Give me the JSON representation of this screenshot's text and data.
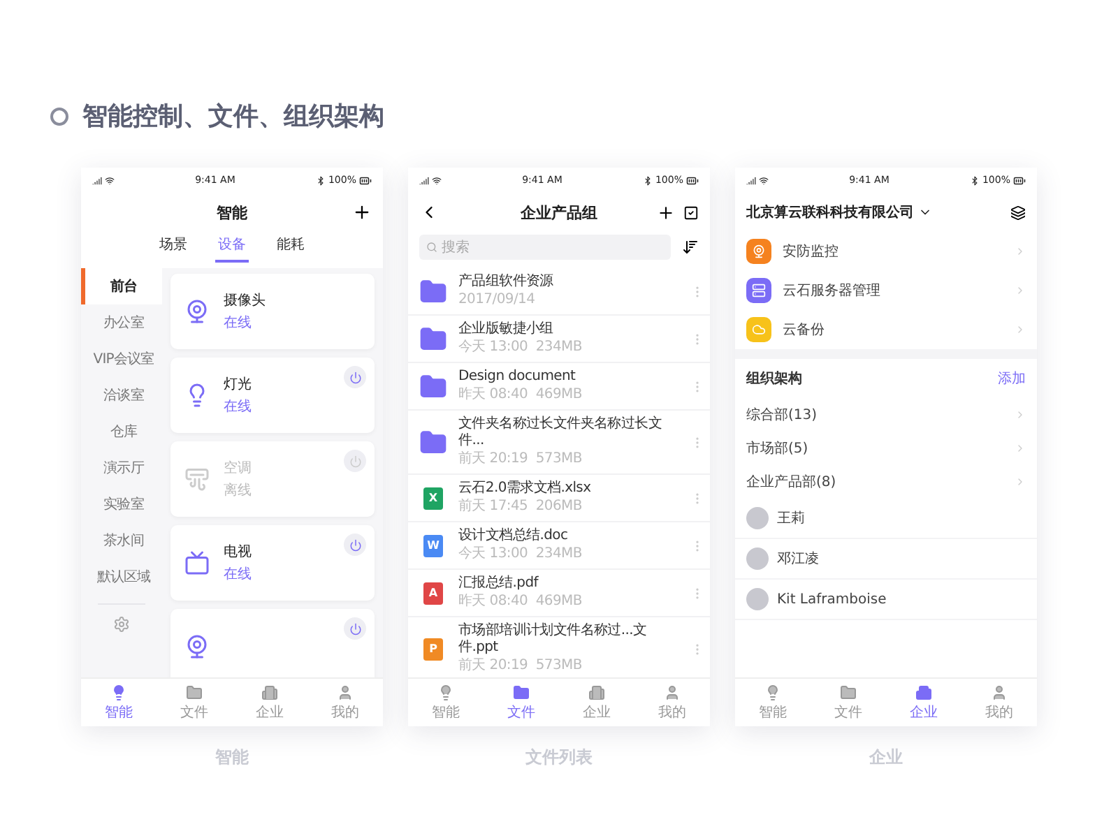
{
  "heading": "智能控制、文件、组织架构",
  "phones": [
    {
      "kind": "devices",
      "caption": "智能",
      "status": {
        "time": "9:41 AM",
        "battery": "100%"
      },
      "title": "智能",
      "tabs": [
        {
          "label": "场景",
          "selected": false
        },
        {
          "label": "设备",
          "selected": true
        },
        {
          "label": "能耗",
          "selected": false
        }
      ],
      "rooms": [
        {
          "label": "前台",
          "selected": true
        },
        {
          "label": "办公室",
          "selected": false
        },
        {
          "label": "VIP会议室",
          "selected": false
        },
        {
          "label": "洽谈室",
          "selected": false
        },
        {
          "label": "仓库",
          "selected": false
        },
        {
          "label": "演示厅",
          "selected": false
        },
        {
          "label": "实验室",
          "selected": false
        },
        {
          "label": "茶水间",
          "selected": false
        },
        {
          "label": "默认区域",
          "selected": false
        }
      ],
      "devices": [
        {
          "name": "摄像头",
          "status": "在线",
          "online": true,
          "power_button": false
        },
        {
          "name": "灯光",
          "status": "在线",
          "online": true,
          "power_button": true
        },
        {
          "name": "空调",
          "status": "离线",
          "online": false,
          "power_button": true
        },
        {
          "name": "电视",
          "status": "在线",
          "online": true,
          "power_button": true
        },
        {
          "online": true,
          "power_button": true
        }
      ],
      "tabbar": [
        {
          "label": "智能",
          "selected": true
        },
        {
          "label": "文件",
          "selected": false
        },
        {
          "label": "企业",
          "selected": false
        },
        {
          "label": "我的",
          "selected": false
        }
      ]
    },
    {
      "kind": "files",
      "caption": "文件列表",
      "status": {
        "time": "9:41 AM",
        "battery": "100%"
      },
      "title": "企业产品组",
      "search": {
        "placeholder": "搜索"
      },
      "files": [
        {
          "kind": "folder",
          "name": "产品组软件资源",
          "date": "2017/09/14"
        },
        {
          "kind": "folder",
          "name": "企业版敏捷小组",
          "date": "今天 13:00",
          "size": "234MB"
        },
        {
          "kind": "folder",
          "name": "Design document",
          "date": "昨天 08:40",
          "size": "469MB"
        },
        {
          "kind": "folder",
          "name": "文件夹名称过长文件夹名称过长文件...",
          "date": "前天 20:19",
          "size": "573MB"
        },
        {
          "kind": "file",
          "badge": "X",
          "color": "#1fa463",
          "name": "云石2.0需求文档.xlsx",
          "date": "前天 17:45",
          "size": "206MB"
        },
        {
          "kind": "file",
          "badge": "W",
          "color": "#4a8af4",
          "name": "设计文档总结.doc",
          "date": "今天 13:00",
          "size": "234MB"
        },
        {
          "kind": "file",
          "badge": "A",
          "color": "#e04646",
          "name": "汇报总结.pdf",
          "date": "昨天 08:40",
          "size": "469MB"
        },
        {
          "kind": "file",
          "badge": "P",
          "color": "#f08a24",
          "name": "市场部培训计划文件名称过...文件.ppt",
          "date": "前天 20:19",
          "size": "573MB"
        }
      ],
      "tabbar": [
        {
          "label": "智能",
          "selected": false
        },
        {
          "label": "文件",
          "selected": true
        },
        {
          "label": "企业",
          "selected": false
        },
        {
          "label": "我的",
          "selected": false
        }
      ]
    },
    {
      "kind": "org",
      "caption": "企业",
      "status": {
        "time": "9:41 AM",
        "battery": "100%"
      },
      "company": "北京算云联科科技有限公司",
      "apps": [
        {
          "name": "安防监控",
          "color": "#f5821f"
        },
        {
          "name": "云石服务器管理",
          "color": "#7b6cf6"
        },
        {
          "name": "云备份",
          "color": "#f7c21a"
        }
      ],
      "section": {
        "title": "组织架构",
        "action": "添加"
      },
      "departments": [
        "综合部(13)",
        "市场部(5)",
        "企业产品部(8)"
      ],
      "members": [
        "王莉",
        "邓江凌",
        "Kit Laframboise"
      ],
      "tabbar": [
        {
          "label": "智能",
          "selected": false
        },
        {
          "label": "文件",
          "selected": false
        },
        {
          "label": "企业",
          "selected": true
        },
        {
          "label": "我的",
          "selected": false
        }
      ]
    }
  ]
}
